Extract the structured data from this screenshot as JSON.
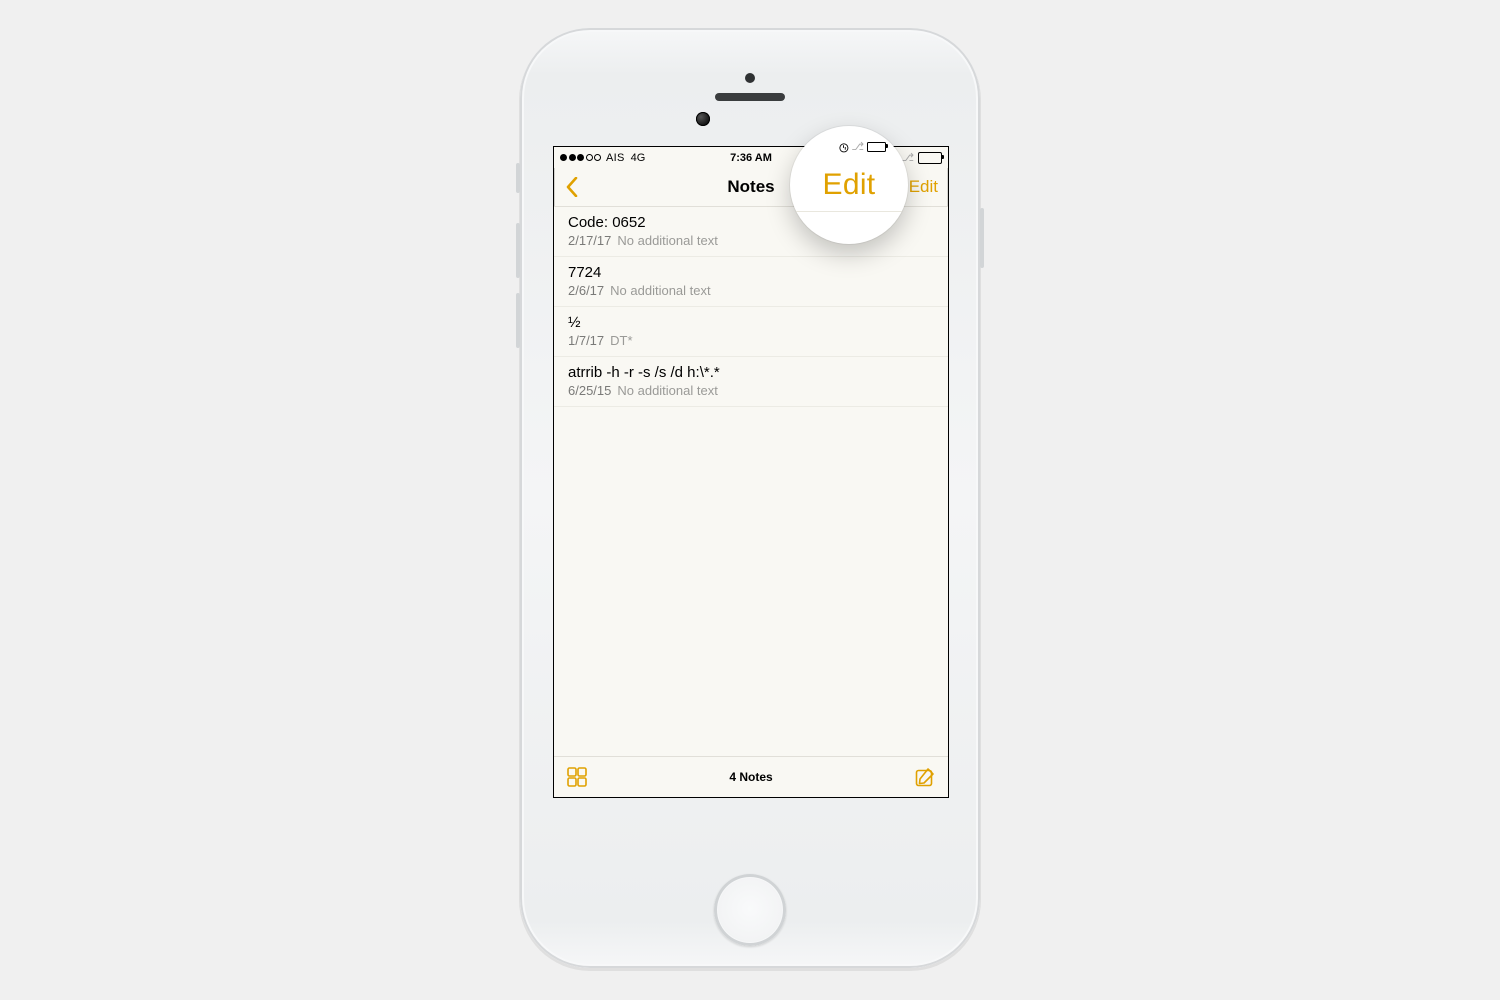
{
  "status": {
    "carrier": "AIS",
    "network": "4G",
    "time": "7:36 AM"
  },
  "navbar": {
    "title": "Notes",
    "edit_label": "Edit"
  },
  "notes": [
    {
      "title": "Code: 0652",
      "date": "2/17/17",
      "preview": "No additional text"
    },
    {
      "title": "7724",
      "date": "2/6/17",
      "preview": "No additional text"
    },
    {
      "title": "½",
      "date": "1/7/17",
      "preview": "DT*"
    },
    {
      "title": "atrrib -h -r -s /s /d h:\\*.*",
      "date": "6/25/15",
      "preview": "No additional text"
    }
  ],
  "toolbar": {
    "count_label": "4 Notes"
  },
  "magnifier": {
    "label": "Edit"
  }
}
